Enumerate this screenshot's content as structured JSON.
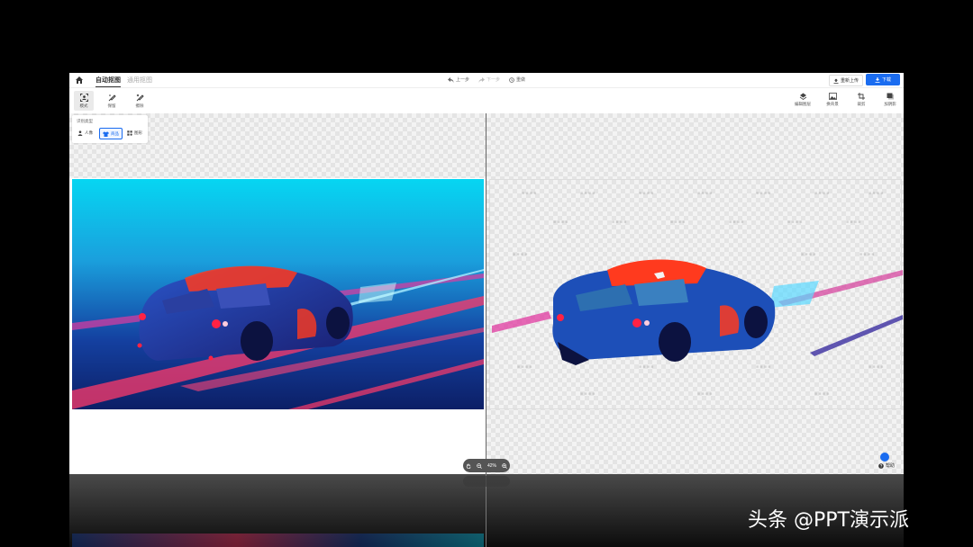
{
  "header": {
    "tabs": [
      {
        "label": "自动抠图",
        "active": true
      },
      {
        "label": "通用抠图",
        "active": false
      }
    ],
    "history": {
      "undo": "上一步",
      "redo": "下一步",
      "reset": "重做"
    },
    "reupload": "重新上传",
    "download": "下载"
  },
  "tools": {
    "left": [
      {
        "label": "模式",
        "icon": "mode-icon",
        "active": true
      },
      {
        "label": "保留",
        "icon": "keep-brush-icon",
        "active": false
      },
      {
        "label": "擦除",
        "icon": "erase-brush-icon",
        "active": false
      }
    ],
    "right": [
      {
        "label": "编辑图层",
        "icon": "layer-edit-icon"
      },
      {
        "label": "换背景",
        "icon": "background-icon"
      },
      {
        "label": "裁剪",
        "icon": "crop-icon"
      },
      {
        "label": "加阴影",
        "icon": "shadow-icon"
      }
    ]
  },
  "recognition": {
    "title": "识别类型",
    "options": [
      {
        "label": "人像",
        "icon": "person-icon",
        "selected": false
      },
      {
        "label": "商品",
        "icon": "product-icon",
        "selected": true
      },
      {
        "label": "图形",
        "icon": "graphic-icon",
        "selected": false
      }
    ]
  },
  "zoom": {
    "level": "42%"
  },
  "help": {
    "label": "帮助"
  },
  "credit": "头条 @PPT演示派",
  "colors": {
    "accent": "#1a6cf0"
  }
}
